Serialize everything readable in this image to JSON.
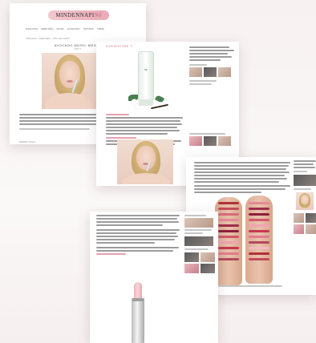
{
  "brand": {
    "logo_text": "MINDENNAPI",
    "logo_accent": "Nő"
  },
  "page1": {
    "nav_items": [
      "MAGAZIN",
      "SZÉPSÉG",
      "DIVAT",
      "GASZTRO",
      "SZTÁRK",
      "TÉMA"
    ],
    "breadcrumb": "FŐOLDAL › SZÉPSÉG › TÁPLÁLKOZÁS",
    "title": "AVOCADO ANGEL MEGAY",
    "subtitle": "MENTS",
    "author": "SZERZŐ: CSILLA"
  },
  "page2": {
    "promo": "SOPHIESTORE ™"
  },
  "colors": {
    "accent": "#e9aab6",
    "text": "#9c9c9c",
    "swatches": [
      "#b0313a",
      "#c24a59",
      "#d66b7c",
      "#e4899a",
      "#a02c4a",
      "#8d1f3c",
      "#d3566d",
      "#f0a3b0",
      "#c7384f",
      "#e37c8c",
      "#b3495e",
      "#f3b8c2"
    ]
  }
}
